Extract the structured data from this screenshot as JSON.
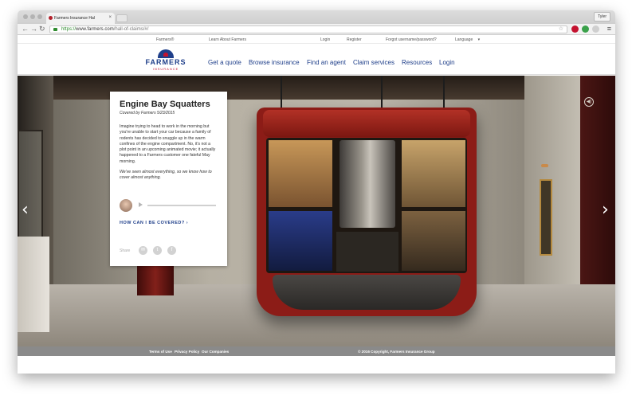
{
  "browser": {
    "tab_title": "Farmers Insurance Hal",
    "tab_close": "×",
    "user": "Tyler",
    "url_scheme": "https://",
    "url_host": "www.farmers.com",
    "url_path": "/hall-of-claims/#/",
    "back": "←",
    "forward": "→",
    "reload": "↻",
    "star": "☆",
    "menu": "≡"
  },
  "utility_bar": {
    "brand": "Farmers®",
    "learn": "Learn About Farmers",
    "login": "Login",
    "register": "Register",
    "forgot": "Forgot username/password?",
    "language": "Language",
    "language_caret": "▾"
  },
  "header": {
    "logo_word": "FARMERS",
    "logo_sub": "INSURANCE",
    "nav": [
      "Get a quote",
      "Browse insurance",
      "Find an agent",
      "Claim services",
      "Resources",
      "Login"
    ]
  },
  "card": {
    "title": "Engine Bay Squatters",
    "byline": "Covered by Farmers 5/23/2015",
    "body": "Imagine trying to head to work in the morning but you're unable to start your car because a family of rodents has decided to snuggle up in the warm confines of the engine compartment. No, it's not a plot point in an upcoming animated movie; it actually happened to a Farmers customer one fateful May morning.",
    "tagline": "We've seen almost everything, so we know how to cover almost anything.",
    "cta": "HOW CAN I BE COVERED?  ›",
    "share_label": "Share",
    "share_icons": [
      "email-icon",
      "twitter-icon",
      "facebook-icon"
    ],
    "share_glyphs": [
      "✉",
      "t",
      "f"
    ],
    "audio_progress": 0
  },
  "hero": {
    "prev": "‹",
    "next": "›",
    "sound": "◀)"
  },
  "footer": {
    "terms": "Terms of Use",
    "privacy": "Privacy Policy",
    "companies": "Our Companies",
    "copyright": "© 2016 Copyright, Farmers Insurance Group"
  }
}
